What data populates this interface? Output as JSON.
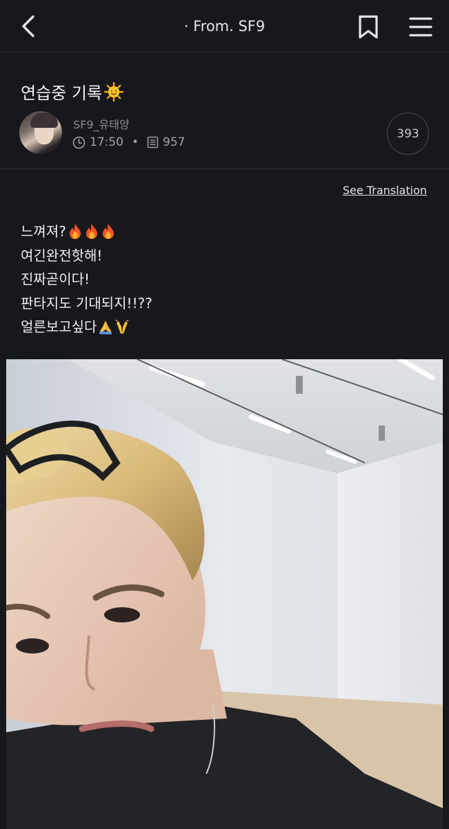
{
  "header": {
    "title": "· From. SF9",
    "back_icon": "chevron-left-icon",
    "bookmark_icon": "bookmark-icon",
    "menu_icon": "hamburger-menu-icon"
  },
  "post": {
    "title": "연습중 기록",
    "title_emoji": "sun-face-emoji",
    "author": "SF9_유태양",
    "time": "17:50",
    "views": "957",
    "comment_count": "393"
  },
  "translation_link": "See Translation",
  "body_lines": [
    {
      "text": "느껴져?",
      "emojis": [
        "fire",
        "fire",
        "fire"
      ]
    },
    {
      "text": "여긴완전핫해!",
      "emojis": []
    },
    {
      "text": "진짜곧이다!",
      "emojis": []
    },
    {
      "text": "판타지도 기대되지!!??",
      "emojis": []
    },
    {
      "text": "얼른보고싶다",
      "emojis": [
        "folded-hands",
        "raising-hands"
      ]
    }
  ],
  "colors": {
    "background": "#17181c",
    "text": "#eeeef0",
    "muted": "#8c8d94"
  }
}
